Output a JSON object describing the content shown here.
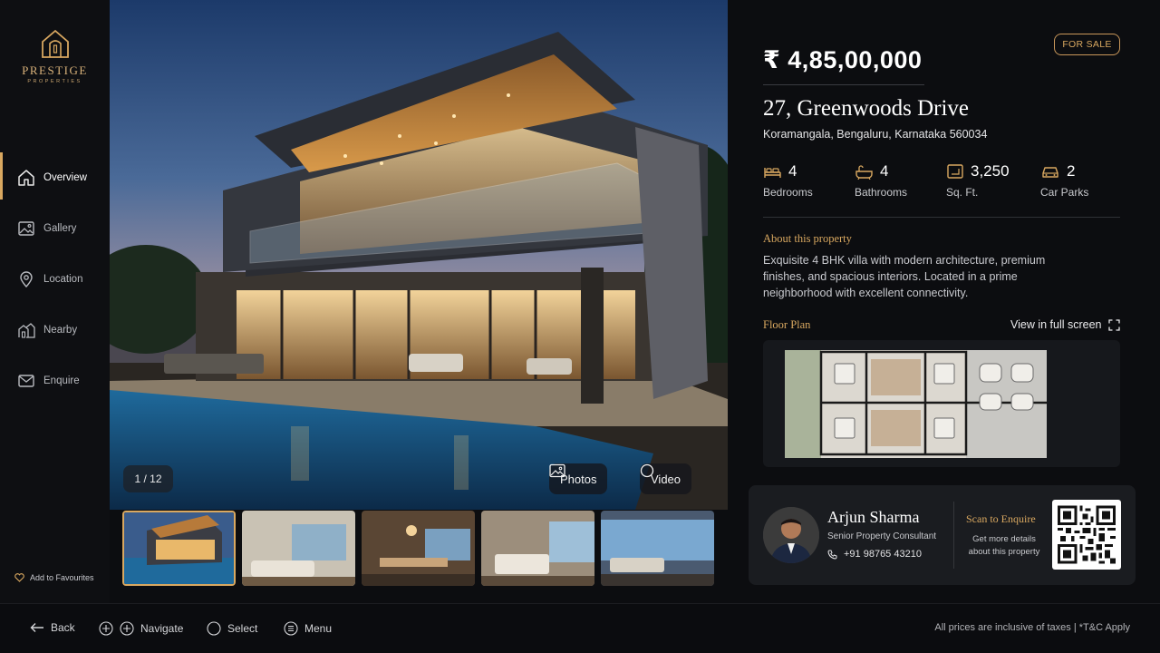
{
  "brand": {
    "name": "PRESTIGE",
    "sub": "PROPERTIES"
  },
  "sidebar": {
    "items": [
      {
        "label": "Overview",
        "icon": "home-icon",
        "active": true
      },
      {
        "label": "Gallery",
        "icon": "image-icon",
        "active": false
      },
      {
        "label": "Location",
        "icon": "map-pin-icon",
        "active": false
      },
      {
        "label": "Nearby",
        "icon": "building-icon",
        "active": false
      },
      {
        "label": "Enquire",
        "icon": "mail-icon",
        "active": false
      }
    ],
    "favourite_label": "Add to Favourites"
  },
  "gallery": {
    "counter": "1 / 12",
    "photos_label": "Photos",
    "video_label": "Video",
    "thumbnail_count": 5,
    "selected_thumbnail": 1
  },
  "listing": {
    "status": "FOR SALE",
    "price": "₹ 4,85,00,000",
    "address": "27, Greenwoods Drive",
    "locality": "Koramangala, Bengaluru, Karnataka 560034",
    "specs": [
      {
        "value": "4",
        "label": "Bedrooms",
        "icon": "bed-icon"
      },
      {
        "value": "4",
        "label": "Bathrooms",
        "icon": "bathtub-icon"
      },
      {
        "value": "3,250",
        "label": "Sq. Ft.",
        "icon": "area-icon"
      },
      {
        "value": "2",
        "label": "Car Parks",
        "icon": "car-icon"
      }
    ],
    "about_title": "About this property",
    "about_text": "Exquisite 4 BHK villa with modern architecture, premium finishes, and spacious interiors. Located in a prime neighborhood with excellent connectivity.",
    "floor_plan_title": "Floor Plan",
    "fullscreen_label": "View in full screen"
  },
  "agent": {
    "name": "Arjun Sharma",
    "role": "Senior Property Consultant",
    "phone": "+91 98765 43210",
    "scan_title": "Scan to Enquire",
    "scan_sub": "Get more details about this property"
  },
  "bottom_bar": {
    "back": "Back",
    "navigate": "Navigate",
    "select": "Select",
    "menu": "Menu",
    "legal": "All prices are inclusive of taxes | *T&C Apply"
  },
  "colors": {
    "accent": "#d9a860",
    "background": "#0c0d10",
    "panel": "#1a1c20"
  }
}
